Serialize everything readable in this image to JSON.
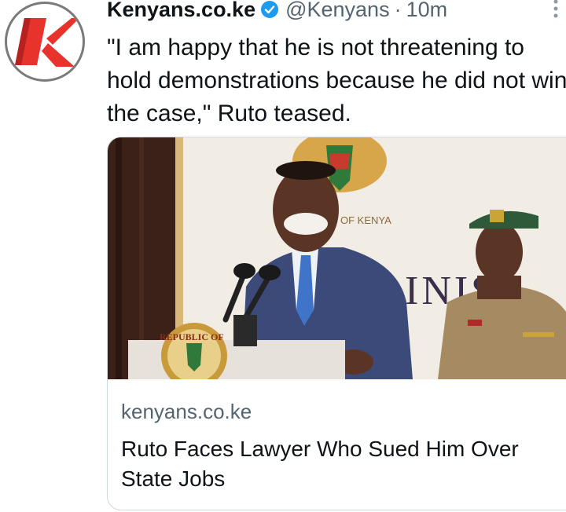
{
  "tweet": {
    "author_name": "Kenyans.co.ke",
    "handle": "@Kenyans",
    "separator": "·",
    "time": "10m",
    "text": "\"I am happy that he is not threatening to hold demonstrations because he did not win the case,\" Ruto teased.",
    "avatar_icon": "kenyans-logo-icon",
    "verified_icon": "verified-badge-icon",
    "more_icon": "more-options-icon"
  },
  "card": {
    "domain": "kenyans.co.ke",
    "title": "Ruto Faces Lawyer Who Sued Him Over State Jobs",
    "image_text": {
      "emblem_fragment": "OF KENYA",
      "wall_fragment": "INIST",
      "seal_fragment": "REPUBLIC OF"
    }
  },
  "colors": {
    "brand_red": "#e8322c",
    "verified_blue": "#1d9bf0",
    "secondary_text": "#536471",
    "border": "#cfd9de"
  }
}
